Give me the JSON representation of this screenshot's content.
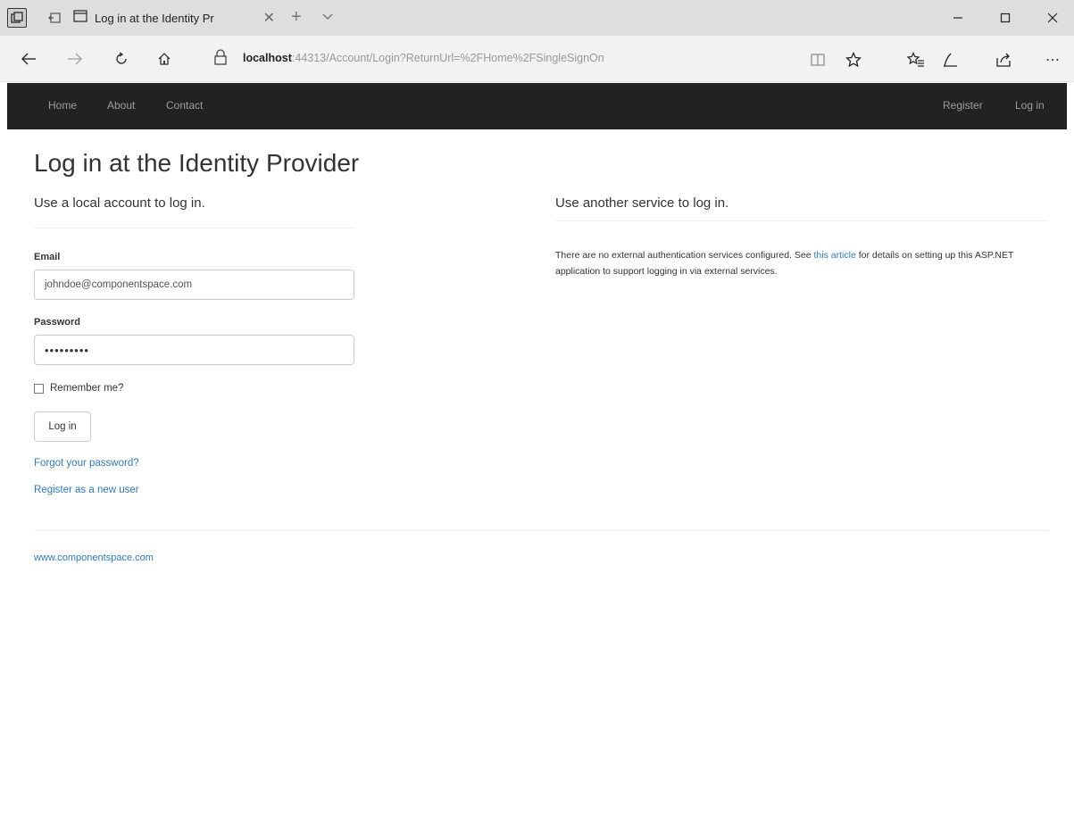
{
  "browser": {
    "tab_title": "Log in at the Identity Pr",
    "url_host": "localhost",
    "url_rest": ":44313/Account/Login?ReturnUrl=%2FHome%2FSingleSignOn"
  },
  "navbar": {
    "left": [
      "Home",
      "About",
      "Contact"
    ],
    "right": [
      "Register",
      "Log in"
    ]
  },
  "page": {
    "title": "Log in at the Identity Provider",
    "local_heading": "Use a local account to log in.",
    "external_heading": "Use another service to log in.",
    "email_label": "Email",
    "email_value": "johndoe@componentspace.com",
    "password_label": "Password",
    "password_value": "•••••••••",
    "remember_label": "Remember me?",
    "login_button": "Log in",
    "forgot_link": "Forgot your password?",
    "register_link": "Register as a new user",
    "external_text_1": "There are no external authentication services configured. See ",
    "external_link": "this article",
    "external_text_2": " for details on setting up this ASP.NET application to support logging in via external services."
  },
  "footer": {
    "link": "www.componentspace.com"
  },
  "icons": [
    "tab-actions-icon",
    "back-tabs-icon",
    "page-icon",
    "close-icon",
    "plus-icon",
    "chevron-down-icon",
    "minimize-icon",
    "maximize-icon",
    "window-close-icon",
    "back-arrow-icon",
    "forward-arrow-icon",
    "refresh-icon",
    "home-icon",
    "lock-icon",
    "reading-view-icon",
    "favorite-star-icon",
    "favorites-hub-icon",
    "pen-icon",
    "share-icon",
    "more-icon"
  ],
  "colors": {
    "navbar_bg": "#222222",
    "navbar_text": "#9d9d9d",
    "link": "#337ab7"
  }
}
